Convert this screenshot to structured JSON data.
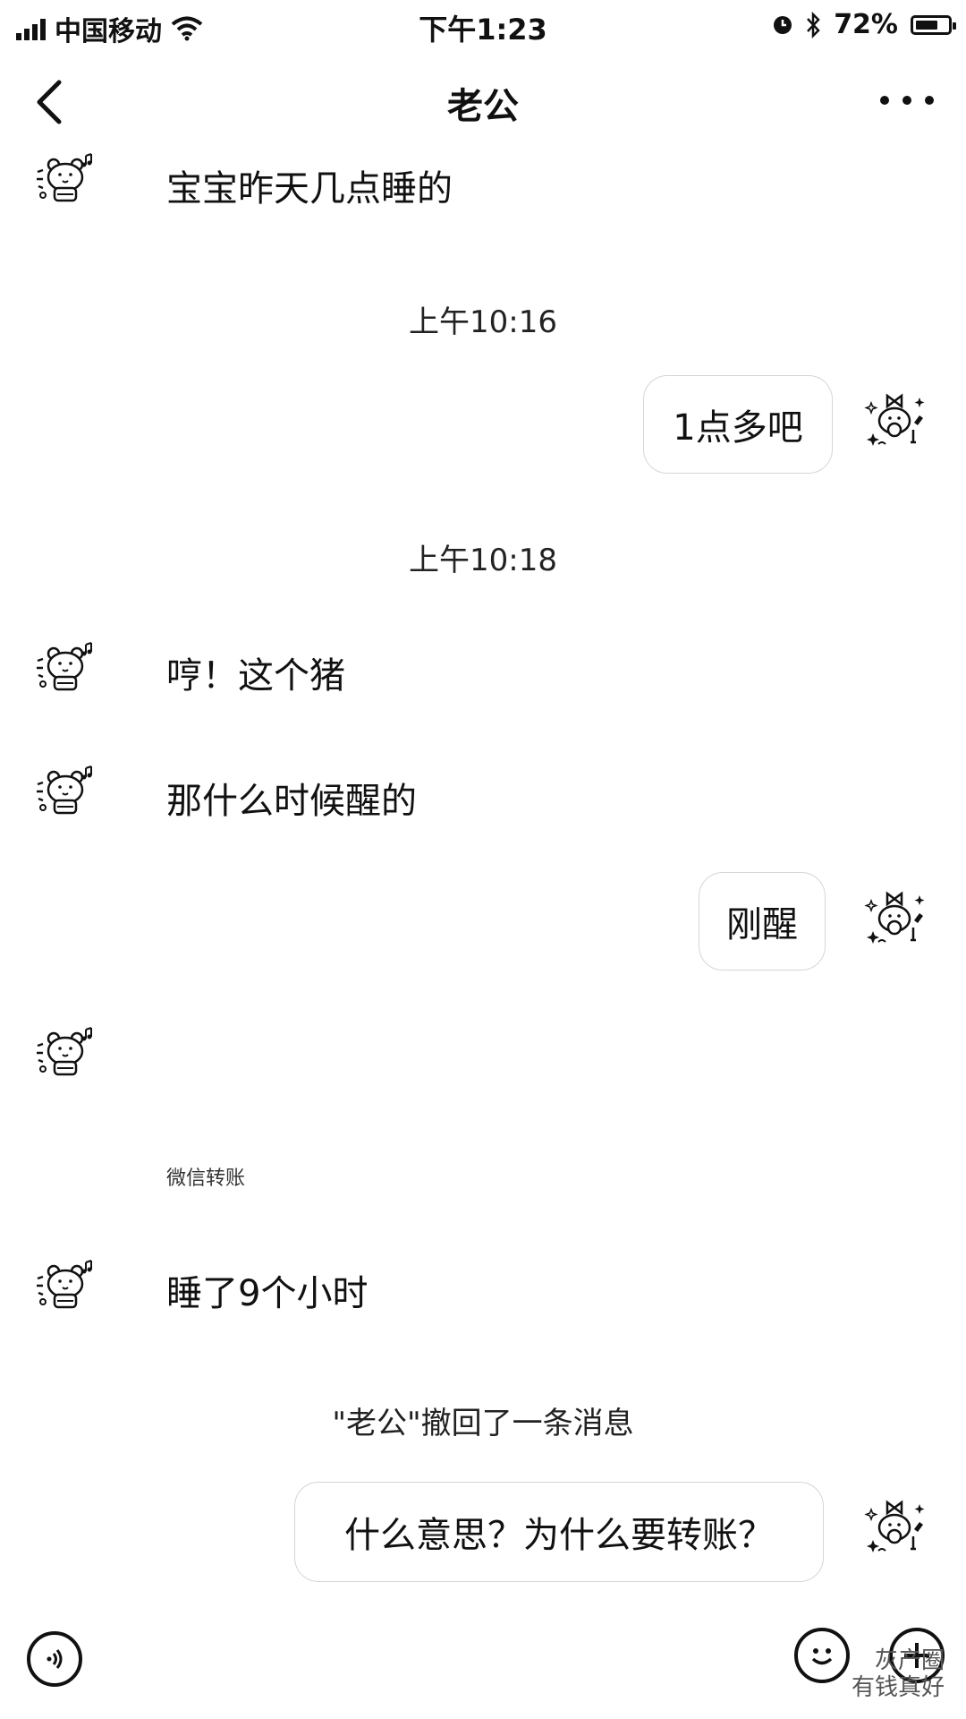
{
  "status_bar": {
    "carrier": "中国移动",
    "time": "下午1:23",
    "battery_percent_text": "72%",
    "battery_level": 0.72
  },
  "nav": {
    "title": "老公"
  },
  "messages": {
    "m1": "宝宝昨天几点睡的",
    "time1": "上午10:16",
    "m2": "1点多吧",
    "time2": "上午10:18",
    "m3": "哼！这个猪",
    "m4": "那什么时候醒的",
    "m5": "刚醒",
    "transfer_caption": "微信转账",
    "m6": "睡了9个小时",
    "recall": "\"老公\"撤回了一条消息",
    "m7": "什么意思？为什么要转账？"
  },
  "icons": {
    "back": "chevron-left-icon",
    "more": "more-dots-icon",
    "voice": "voice-icon",
    "emoji": "emoji-icon",
    "plus": "plus-icon",
    "avatar_left": "bear-avatar",
    "avatar_right": "bear-with-bow-avatar"
  },
  "watermark": {
    "line1": "灰产圈",
    "line2": "有钱真好"
  }
}
